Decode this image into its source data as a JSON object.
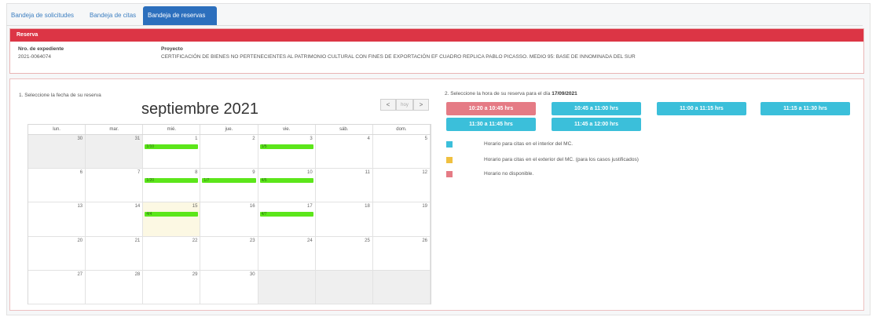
{
  "tabs": [
    {
      "label": "Bandeja de solicitudes"
    },
    {
      "label": "Bandeja de citas"
    },
    {
      "label": "Bandeja de reservas"
    }
  ],
  "reserva": {
    "header": "Reserva",
    "expediente_label": "Nro. de expediente",
    "expediente_value": "2021-0064074",
    "proyecto_label": "Proyecto",
    "proyecto_value": "CERTIFICACIÓN DE BIENES NO PERTENECIENTES AL PATRIMONIO CULTURAL CON FINES DE EXPORTACIÓN EF CUADRO REPLICA PABLO PICASSO. MEDIO 95: BASE DE INNOMINADA DEL SUR"
  },
  "calendar": {
    "step_label": "1. Seleccione la fecha de su reserva",
    "title": "septiembre 2021",
    "nav": {
      "prev": "<",
      "today": "hoy",
      "next": ">"
    },
    "weekdays": [
      "lun.",
      "mar.",
      "mié.",
      "jue.",
      "vie.",
      "sáb.",
      "dom."
    ],
    "weeks": [
      [
        {
          "day": "30",
          "other": true
        },
        {
          "day": "31",
          "other": true
        },
        {
          "day": "1",
          "event": "1/10"
        },
        {
          "day": "2"
        },
        {
          "day": "3",
          "event": "1/5"
        },
        {
          "day": "4"
        },
        {
          "day": "5"
        }
      ],
      [
        {
          "day": "6"
        },
        {
          "day": "7"
        },
        {
          "day": "8",
          "event": "1/20"
        },
        {
          "day": "9",
          "event": "1/7"
        },
        {
          "day": "10",
          "event": "4/5"
        },
        {
          "day": "11"
        },
        {
          "day": "12"
        }
      ],
      [
        {
          "day": "13"
        },
        {
          "day": "14"
        },
        {
          "day": "15",
          "event": "4/4",
          "today": true
        },
        {
          "day": "16"
        },
        {
          "day": "17",
          "event": "4/7"
        },
        {
          "day": "18"
        },
        {
          "day": "19"
        }
      ],
      [
        {
          "day": "20"
        },
        {
          "day": "21"
        },
        {
          "day": "22"
        },
        {
          "day": "23"
        },
        {
          "day": "24"
        },
        {
          "day": "25"
        },
        {
          "day": "26"
        }
      ],
      [
        {
          "day": "27"
        },
        {
          "day": "28"
        },
        {
          "day": "29"
        },
        {
          "day": "30"
        },
        {
          "day": "",
          "other": true
        },
        {
          "day": "",
          "other": true
        },
        {
          "day": "",
          "other": true
        }
      ]
    ]
  },
  "slots": {
    "step_label": "2. Seleccione la hora de su reserva para el día",
    "selected_date": "17/09/2021",
    "items": [
      {
        "label": "10:20 a 10:45 hrs",
        "status": "red"
      },
      {
        "label": "10:45 a 11:00 hrs",
        "status": "blue"
      },
      {
        "label": "11:00 a 11:15 hrs",
        "status": "blue"
      },
      {
        "label": "11:15 a 11:30 hrs",
        "status": "blue"
      },
      {
        "label": "11:30 a 11:45 hrs",
        "status": "blue"
      },
      {
        "label": "11:45 a 12:00 hrs",
        "status": "blue"
      }
    ]
  },
  "legend": [
    {
      "color": "#3bbfda",
      "label": "Horario para citas en el interior del MC."
    },
    {
      "color": "#f0c040",
      "label": "Horario para citas en el exterior del MC. (para los casos justificados)"
    },
    {
      "color": "#e57b85",
      "label": "Horario no disponible."
    }
  ]
}
